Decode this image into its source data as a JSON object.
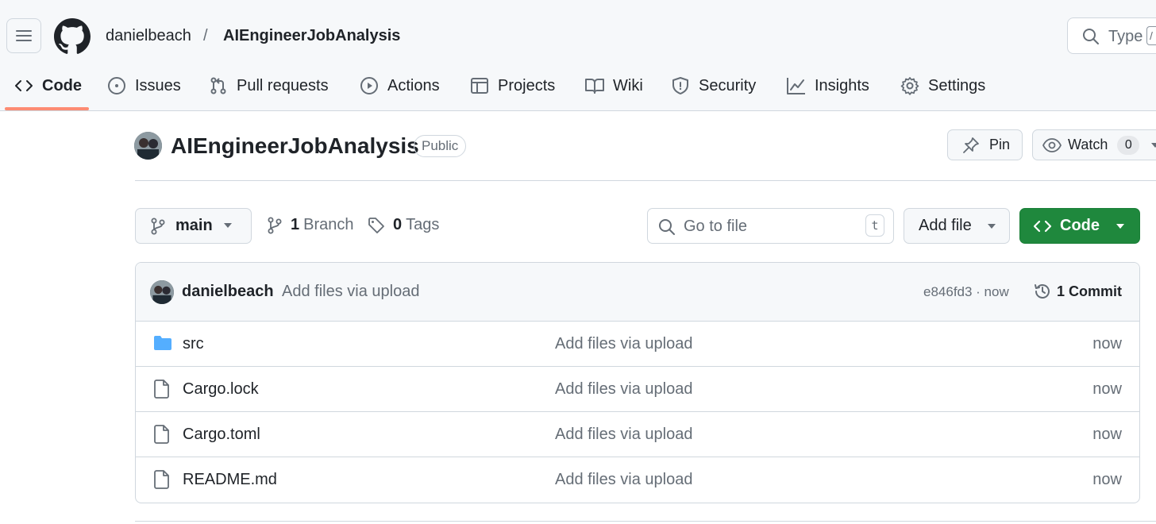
{
  "header": {
    "owner": "danielbeach",
    "separator": "/",
    "repo": "AIEngineerJobAnalysis",
    "search_placeholder": "Type",
    "search_hint": "/"
  },
  "nav": {
    "tabs": [
      {
        "label": "Code",
        "icon": "code-icon",
        "active": true
      },
      {
        "label": "Issues",
        "icon": "issue-icon"
      },
      {
        "label": "Pull requests",
        "icon": "pull-request-icon"
      },
      {
        "label": "Actions",
        "icon": "play-icon"
      },
      {
        "label": "Projects",
        "icon": "table-icon"
      },
      {
        "label": "Wiki",
        "icon": "book-icon"
      },
      {
        "label": "Security",
        "icon": "shield-icon"
      },
      {
        "label": "Insights",
        "icon": "graph-icon"
      },
      {
        "label": "Settings",
        "icon": "gear-icon"
      }
    ]
  },
  "repo": {
    "title": "AIEngineerJobAnalysis",
    "visibility": "Public",
    "pin_label": "Pin",
    "watch_label": "Watch",
    "watch_count": "0"
  },
  "toolbar": {
    "branch": "main",
    "branch_count": "1",
    "branch_label": "Branch",
    "tag_count": "0",
    "tag_label": "Tags",
    "goto_placeholder": "Go to file",
    "goto_shortcut": "t",
    "add_file_label": "Add file",
    "code_label": "Code"
  },
  "commit": {
    "author": "danielbeach",
    "message": "Add files via upload",
    "meta": "e846fd3 · now",
    "count_label": "1 Commit"
  },
  "files": [
    {
      "name": "src",
      "type": "folder",
      "message": "Add files via upload",
      "time": "now"
    },
    {
      "name": "Cargo.lock",
      "type": "file",
      "message": "Add files via upload",
      "time": "now"
    },
    {
      "name": "Cargo.toml",
      "type": "file",
      "message": "Add files via upload",
      "time": "now"
    },
    {
      "name": "README.md",
      "type": "file",
      "message": "Add files via upload",
      "time": "now"
    }
  ],
  "colors": {
    "accent_underline": "#fd8c73",
    "primary_button": "#1f883d",
    "folder_icon": "#54aeff"
  }
}
